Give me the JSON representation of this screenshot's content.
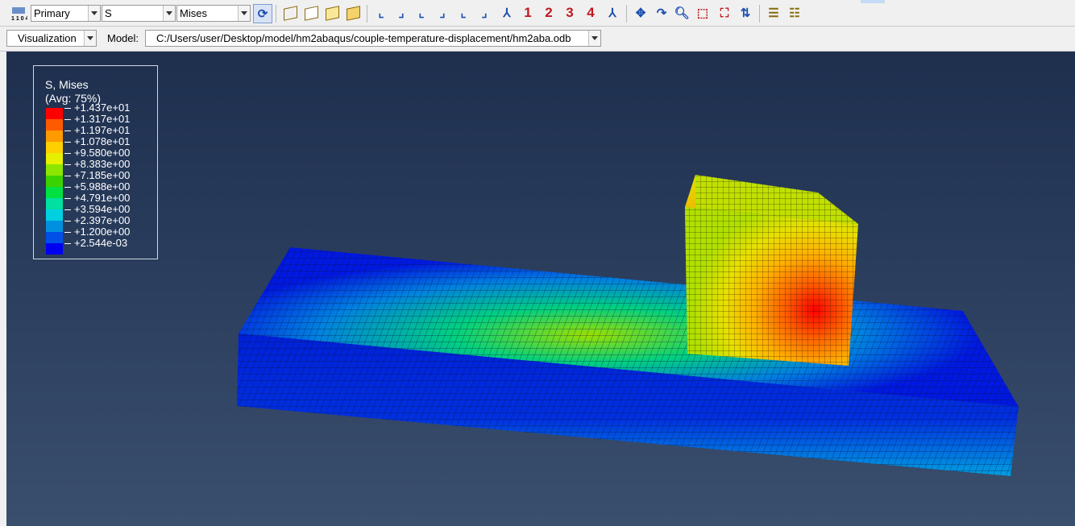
{
  "toolbar1": {
    "step_selector": "Primary",
    "variable": "S",
    "component": "Mises",
    "view_numbers": [
      "1",
      "2",
      "3",
      "4"
    ]
  },
  "toolbar2": {
    "module": "Visualization",
    "model_label": "Model:",
    "model_path": "C:/Users/user/Desktop/model/hm2abaqus/couple-temperature-displacement/hm2aba.odb"
  },
  "legend": {
    "title": "S, Mises",
    "subtitle": "(Avg: 75%)",
    "levels": [
      "+1.437e+01",
      "+1.317e+01",
      "+1.197e+01",
      "+1.078e+01",
      "+9.580e+00",
      "+8.383e+00",
      "+7.185e+00",
      "+5.988e+00",
      "+4.791e+00",
      "+3.594e+00",
      "+2.397e+00",
      "+1.200e+00",
      "+2.544e-03"
    ],
    "colors": [
      "#ff0000",
      "#ff5a00",
      "#ff9a00",
      "#ffd000",
      "#e6f000",
      "#8ce600",
      "#3cd200",
      "#00e040",
      "#00e0a0",
      "#00d0e0",
      "#0090e0",
      "#0050e8",
      "#0000f0"
    ]
  },
  "colors": {
    "viewport_top": "#1e2f4e",
    "viewport_bottom": "#3a4e6e"
  }
}
